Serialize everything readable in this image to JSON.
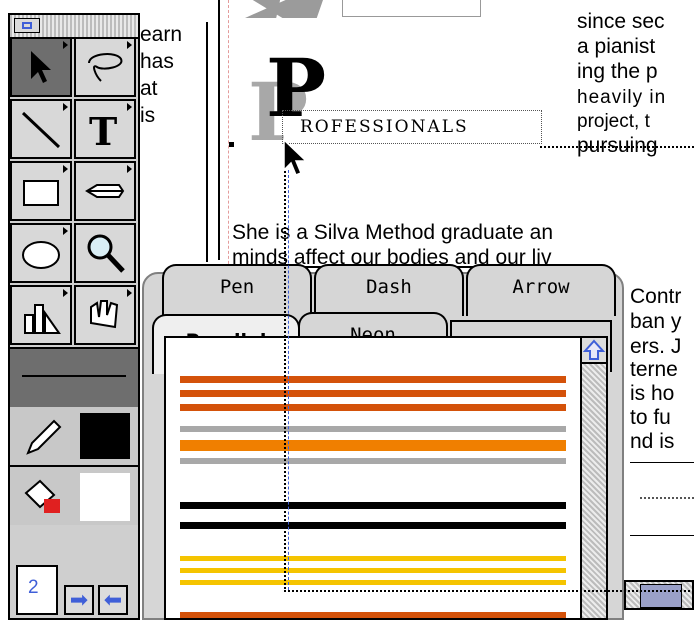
{
  "document": {
    "left_col": [
      "earn",
      "has",
      "at",
      "is"
    ],
    "right_col": [
      "since sec",
      "a pianist",
      "ing the p",
      "heavily in",
      "project, t",
      "pursuing"
    ],
    "body_lines": [
      "She is a Silva Method graduate an",
      "minds affect our bodies and our liv"
    ],
    "right_behind": [
      "Contr",
      "ban y",
      "ers. J",
      "terne",
      "is ho",
      "to fu",
      "nd is"
    ],
    "banner_initial": "P",
    "banner_word": "ROFESSIONALS"
  },
  "toolbox": {
    "tools": [
      {
        "name": "pointer-tool",
        "selected": true
      },
      {
        "name": "lasso-tool",
        "selected": false
      },
      {
        "name": "line-tool",
        "selected": false
      },
      {
        "name": "text-tool",
        "selected": false
      },
      {
        "name": "rectangle-tool",
        "selected": false
      },
      {
        "name": "pen-tool",
        "selected": false
      },
      {
        "name": "ellipse-tool",
        "selected": false
      },
      {
        "name": "zoom-tool",
        "selected": false
      },
      {
        "name": "chart-tool",
        "selected": false
      },
      {
        "name": "grabber-tool",
        "selected": false
      }
    ],
    "page_number": "2"
  },
  "palette": {
    "tabs_back": [
      "Pen",
      "Dash",
      "Arrow"
    ],
    "tabs_front": [
      "Parallel",
      "Neon",
      ""
    ],
    "active_tab": "Parallel",
    "line_styles": [
      {
        "colors": [
          "#d4520a",
          "#d4520a",
          "#d4520a"
        ]
      },
      {
        "colors": [
          "#a8a8a8",
          "#f07f00",
          "#a8a8a8"
        ]
      },
      {
        "colors": [
          "#000000",
          "#000000"
        ]
      },
      {
        "colors": [
          "#f5c400",
          "#f5c400",
          "#f5c400"
        ]
      },
      {
        "colors": [
          "#d4520a"
        ]
      }
    ]
  }
}
